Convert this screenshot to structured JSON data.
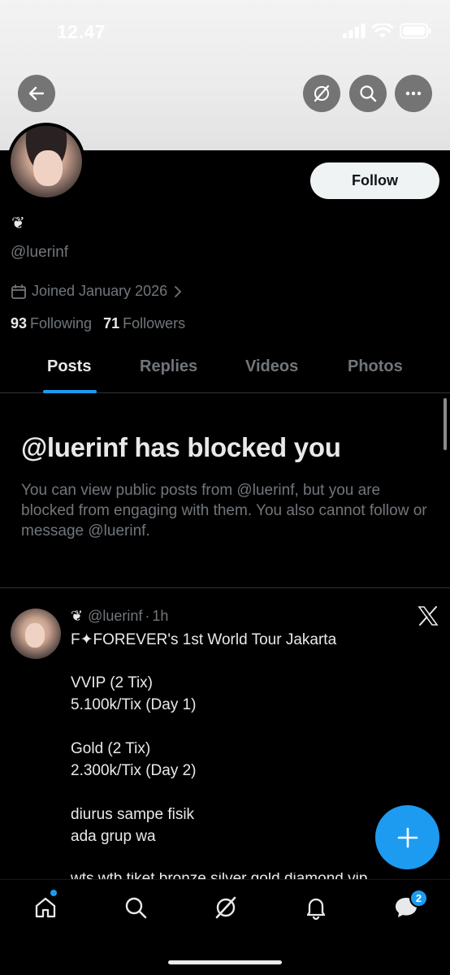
{
  "status_bar": {
    "time": "12.47"
  },
  "profile": {
    "emoji": "❦",
    "handle": "@luerinf",
    "joined": "Joined January 2026",
    "following_count": "93",
    "following_label": "Following",
    "followers_count": "71",
    "followers_label": "Followers",
    "follow_label": "Follow"
  },
  "tabs": [
    {
      "label": "Posts",
      "active": true
    },
    {
      "label": "Replies",
      "active": false
    },
    {
      "label": "Videos",
      "active": false
    },
    {
      "label": "Photos",
      "active": false
    }
  ],
  "blocked": {
    "title": "@luerinf has blocked you",
    "body": "You can view public posts from @luerinf, but you are blocked from engaging with them. You also cannot follow or message @luerinf."
  },
  "post": {
    "emoji": "❦",
    "handle": "@luerinf",
    "separator": "·",
    "time": "1h",
    "lines": [
      "F✦FOREVER's 1st World Tour Jakarta",
      "VVIP (2 Tix)",
      "5.100k/Tix (Day 1)",
      "Gold (2 Tix)",
      "2.300k/Tix (Day 2)",
      "diurus sampe fisik",
      "ada grup wa",
      "wts wtb tiket bronze silver gold diamond vip"
    ]
  },
  "nav": {
    "messages_badge": "2"
  },
  "colors": {
    "accent": "#1d9bf0",
    "background": "#000000",
    "muted_text": "#71767b",
    "primary_text": "#e7e9ea"
  }
}
